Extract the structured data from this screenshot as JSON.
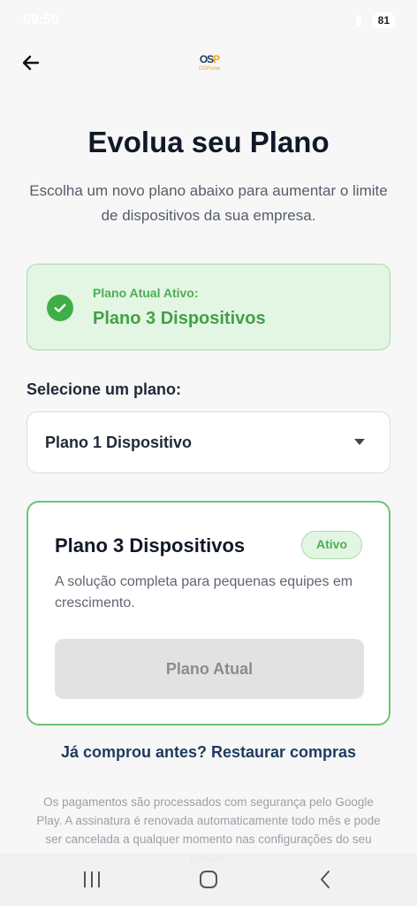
{
  "status_bar": {
    "time": "09:50",
    "battery": "81"
  },
  "header": {
    "logo_mark": "OS",
    "logo_mark_accent": "P",
    "logo_text": "OSPrime"
  },
  "page": {
    "title": "Evolua seu Plano",
    "subtitle": "Escolha um novo plano abaixo para aumentar o limite de dispositivos da sua empresa."
  },
  "current_plan": {
    "label": "Plano Atual Ativo:",
    "name": "Plano 3 Dispositivos"
  },
  "plan_select": {
    "label": "Selecione um plano:",
    "selected": "Plano 1 Dispositivo"
  },
  "plan_card": {
    "name": "Plano 3 Dispositivos",
    "badge": "Ativo",
    "description": "A solução completa para pequenas equipes em crescimento.",
    "button_label": "Plano Atual"
  },
  "restore_link": "Já comprou antes? Restaurar compras",
  "footer_note": "Os pagamentos são processados com segurança pelo Google Play. A assinatura é renovada automaticamente todo mês e pode ser cancelada a qualquer momento nas configurações do seu celular.",
  "colors": {
    "accent_green": "#4caf50",
    "title_dark": "#111827",
    "link_navy": "#1e3a5f",
    "logo_orange": "#f5a623"
  },
  "icons": {
    "back": "arrow-left-icon",
    "check": "check-circle-icon",
    "dropdown": "caret-down-icon",
    "nav_recents": "recents-icon",
    "nav_home": "home-icon",
    "nav_back": "back-chevron-icon"
  }
}
